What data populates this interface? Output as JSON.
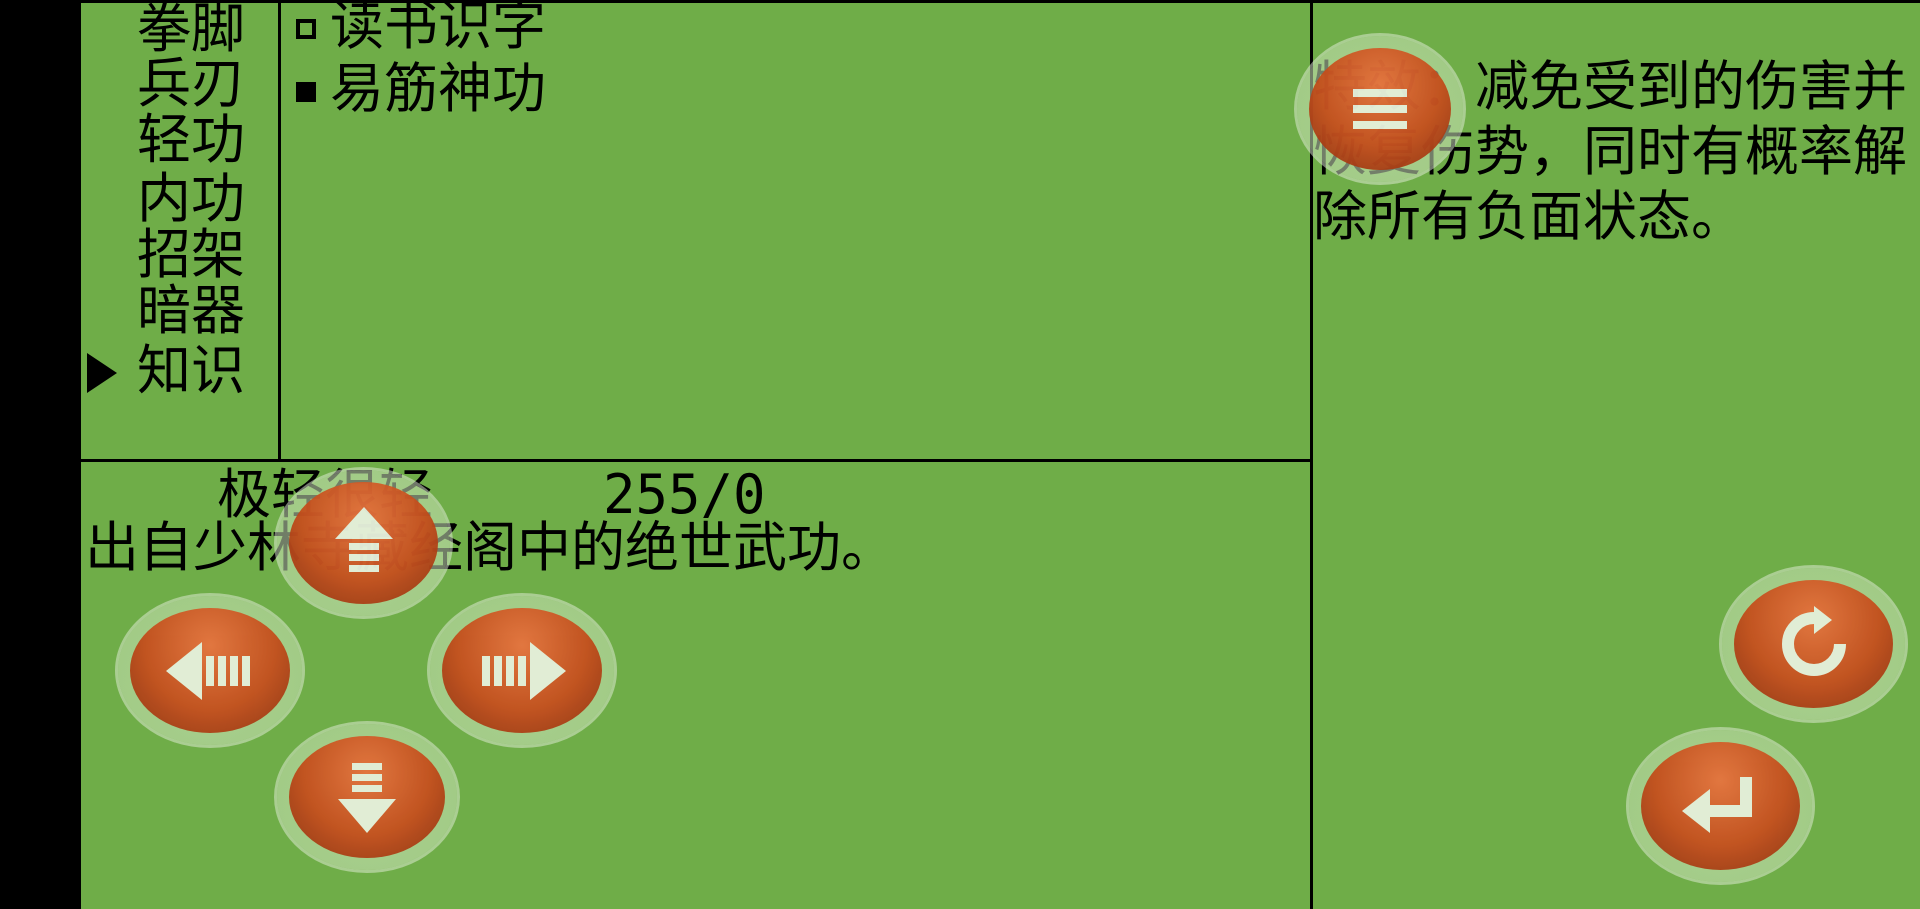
{
  "categories": [
    "拳脚",
    "兵刃",
    "轻功",
    "内功",
    "招架",
    "暗器",
    "知识"
  ],
  "selected_category": "知识",
  "skills": [
    {
      "label": "读书识字",
      "checked": false
    },
    {
      "label": "易筋神功",
      "checked": true
    }
  ],
  "description": "特效：减免受到的伤害并恢复伤势，同时有概率解除所有负面状态。",
  "stats": {
    "weight": "极轻很轻",
    "values": "255/0"
  },
  "origin": "出自少林寺藏经阁中的绝世武功。",
  "colors": {
    "screen_bg": "#6fad48",
    "letterbox": "#000000",
    "button": "#c44a18"
  },
  "controls": {
    "menu": "menu-icon",
    "up": "arrow-up-icon",
    "left": "arrow-left-icon",
    "right": "arrow-right-icon",
    "down": "arrow-down-icon",
    "refresh": "refresh-icon",
    "enter": "enter-icon"
  }
}
